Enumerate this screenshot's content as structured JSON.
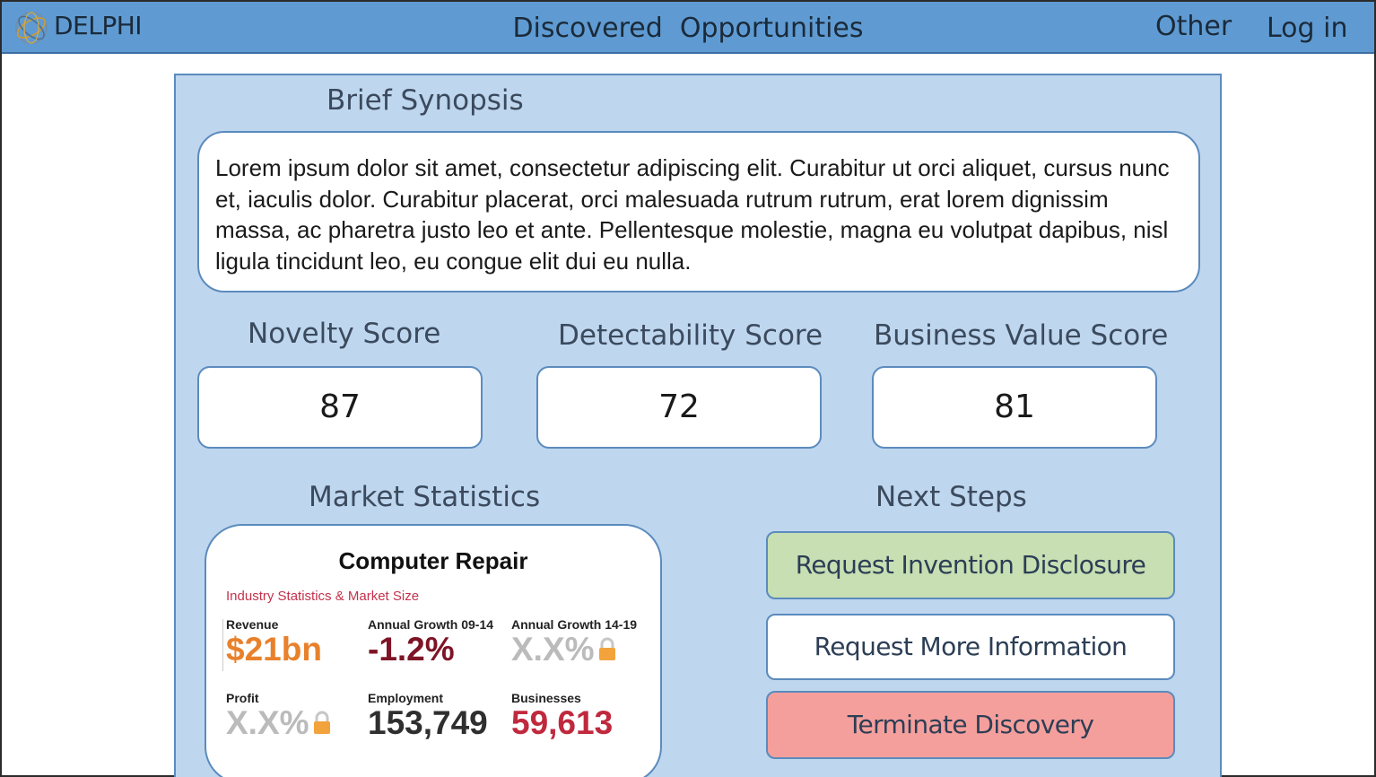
{
  "header": {
    "brand": "DELPHI",
    "title": "Discovered  Opportunities",
    "nav_other": "Other",
    "nav_login": "Log in"
  },
  "synopsis": {
    "heading": "Brief Synopsis",
    "text": "Lorem ipsum dolor sit amet, consectetur adipiscing elit. Curabitur ut orci aliquet, cursus nunc et, iaculis dolor. Curabitur placerat, orci malesuada rutrum rutrum, erat lorem dignissim massa, ac pharetra justo leo et ante. Pellentesque molestie, magna eu volutpat dapibus, nisl ligula tincidunt leo, eu congue elit dui eu nulla."
  },
  "scores": [
    {
      "label": "Novelty Score",
      "value": "87"
    },
    {
      "label": "Detectability Score",
      "value": "72"
    },
    {
      "label": "Business Value Score",
      "value": "81"
    }
  ],
  "market": {
    "heading": "Market Statistics",
    "card_title": "Computer Repair",
    "subtitle": "Industry Statistics & Market Size",
    "stats": [
      {
        "label": "Revenue",
        "value": "$21bn"
      },
      {
        "label": "Annual Growth 09-14",
        "value": "-1.2%"
      },
      {
        "label": "Annual Growth 14-19",
        "value": "X.X%"
      },
      {
        "label": "Profit",
        "value": "X.X%"
      },
      {
        "label": "Employment",
        "value": "153,749"
      },
      {
        "label": "Businesses",
        "value": "59,613"
      }
    ]
  },
  "next_steps": {
    "heading": "Next Steps",
    "buttons": [
      {
        "label": "Request Invention Disclosure",
        "color": "#c7dfb2"
      },
      {
        "label": "Request More Information",
        "color": "#ffffff"
      },
      {
        "label": "Terminate Discovery",
        "color": "#f59f9c"
      }
    ]
  },
  "colors": {
    "header_bg": "#5f9bd2",
    "panel_bg": "#bed6ee",
    "border": "#5b8bbd",
    "revenue": "#e8812c",
    "growth": "#7e1426",
    "locked": "#bbbbbb",
    "businesses": "#c0293d"
  },
  "icons": {
    "logo": "globe-logo-icon",
    "lock": "lock-icon"
  }
}
